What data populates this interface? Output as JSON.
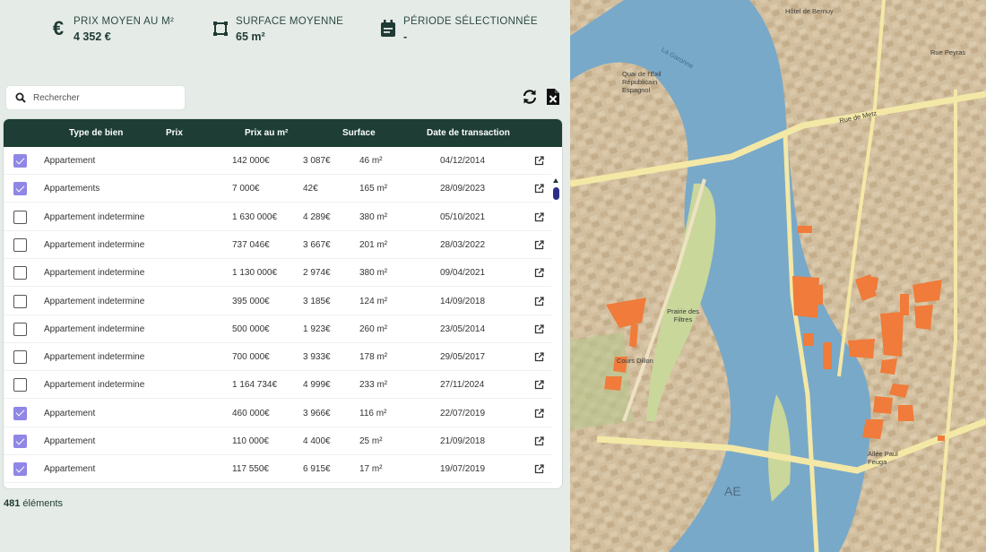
{
  "stats": [
    {
      "icon": "euro-icon",
      "label": "Prix moyen au m²",
      "value": "4 352 €"
    },
    {
      "icon": "square-area-icon",
      "label": "Surface moyenne",
      "value": "65 m²"
    },
    {
      "icon": "calendar-icon",
      "label": "Période sélectionnée",
      "value": "-"
    }
  ],
  "search": {
    "placeholder": "Rechercher",
    "value": ""
  },
  "toolbar": {
    "refresh_icon": "refresh-icon",
    "export_icon": "excel-export-icon"
  },
  "table": {
    "columns": [
      "Type de bien",
      "Prix",
      "Prix au m²",
      "Surface",
      "Date de transaction"
    ],
    "rows": [
      {
        "checked": true,
        "type": "Appartement",
        "prix": "142 000€",
        "prix_m2": "3 087€",
        "surface": "46 m²",
        "date": "04/12/2014"
      },
      {
        "checked": true,
        "type": "Appartements",
        "prix": "7 000€",
        "prix_m2": "42€",
        "surface": "165 m²",
        "date": "28/09/2023"
      },
      {
        "checked": false,
        "type": "Appartement indetermine",
        "prix": "1 630 000€",
        "prix_m2": "4 289€",
        "surface": "380 m²",
        "date": "05/10/2021"
      },
      {
        "checked": false,
        "type": "Appartement indetermine",
        "prix": "737 046€",
        "prix_m2": "3 667€",
        "surface": "201 m²",
        "date": "28/03/2022"
      },
      {
        "checked": false,
        "type": "Appartement indetermine",
        "prix": "1 130 000€",
        "prix_m2": "2 974€",
        "surface": "380 m²",
        "date": "09/04/2021"
      },
      {
        "checked": false,
        "type": "Appartement indetermine",
        "prix": "395 000€",
        "prix_m2": "3 185€",
        "surface": "124 m²",
        "date": "14/09/2018"
      },
      {
        "checked": false,
        "type": "Appartement indetermine",
        "prix": "500 000€",
        "prix_m2": "1 923€",
        "surface": "260 m²",
        "date": "23/05/2014"
      },
      {
        "checked": false,
        "type": "Appartement indetermine",
        "prix": "700 000€",
        "prix_m2": "3 933€",
        "surface": "178 m²",
        "date": "29/05/2017"
      },
      {
        "checked": false,
        "type": "Appartement indetermine",
        "prix": "1 164 734€",
        "prix_m2": "4 999€",
        "surface": "233 m²",
        "date": "27/11/2024"
      },
      {
        "checked": true,
        "type": "Appartement",
        "prix": "460 000€",
        "prix_m2": "3 966€",
        "surface": "116 m²",
        "date": "22/07/2019"
      },
      {
        "checked": true,
        "type": "Appartement",
        "prix": "110 000€",
        "prix_m2": "4 400€",
        "surface": "25 m²",
        "date": "21/09/2018"
      },
      {
        "checked": true,
        "type": "Appartement",
        "prix": "117 550€",
        "prix_m2": "6 915€",
        "surface": "17 m²",
        "date": "19/07/2019"
      }
    ]
  },
  "footer": {
    "count": "481",
    "count_label": "éléments"
  },
  "map": {
    "labels": [
      "Hôtel de Bernuy",
      "Quai de l'Exil Républicain Espagnol",
      "Rue de Metz",
      "Prairie des Filtres",
      "Cours Dillon",
      "Allée Paul Feuga",
      "AE",
      "Rue Peyras",
      "La Garonne"
    ],
    "colors": {
      "building_highlight": "#f07b3a",
      "river": "#79a9c9",
      "park": "#c9d79b",
      "road": "#f4e8a6"
    }
  },
  "colors": {
    "header_bg": "#1d3d35",
    "checkbox_on": "#8f86e6",
    "panel_bg": "#e5ebe7"
  }
}
